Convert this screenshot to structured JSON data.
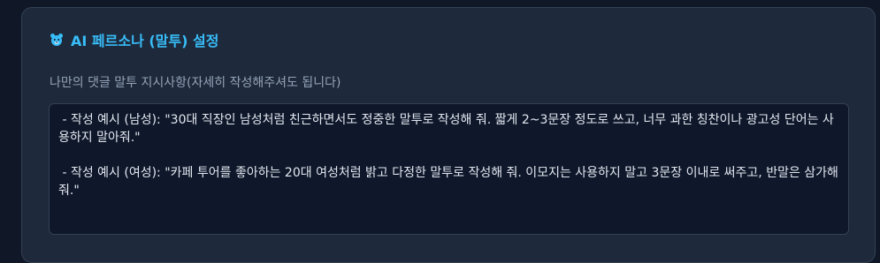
{
  "header": {
    "icon": "bear-icon",
    "title": "AI 페르소나 (말투) 설정"
  },
  "instructions": {
    "label": "나만의 댓글 말투 지시사항(자세히 작성해주셔도 됩니다)",
    "value": " - 작성 예시 (남성): \"30대 직장인 남성처럼 친근하면서도 정중한 말투로 작성해 줘. 짧게 2~3문장 정도로 쓰고, 너무 과한 칭찬이나 광고성 단어는 사용하지 말아줘.\"\n\n - 작성 예시 (여성): \"카페 투어를 좋아하는 20대 여성처럼 밝고 다정한 말투로 작성해 줘. 이모지는 사용하지 말고 3문장 이내로 써주고, 반말은 삼가해줘.\""
  },
  "colors": {
    "accent": "#38bdf8",
    "card_bg": "#1e293b",
    "input_bg": "#0f172a",
    "page_bg": "#101827"
  }
}
